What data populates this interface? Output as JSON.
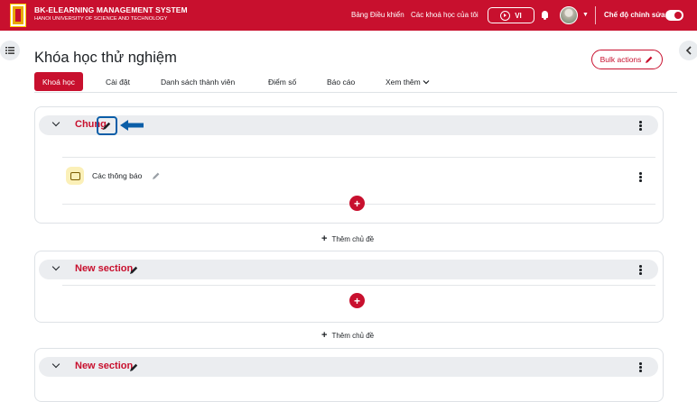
{
  "navbar": {
    "brand_title": "BK-ELEARNING MANAGEMENT SYSTEM",
    "brand_subtitle": "HANOI UNIVERSITY OF SCIENCE AND TECHNOLOGY",
    "dashboard_link": "Bảng Điều khiển",
    "my_courses_link": "Các khoá học của tôi",
    "language": "VI",
    "edit_mode_label": "Chế độ chỉnh sửa"
  },
  "header": {
    "title": "Khóa học thử nghiệm",
    "bulk_actions": "Bulk actions"
  },
  "tabs": [
    {
      "label": "Khoá học",
      "active": true
    },
    {
      "label": "Cài đặt"
    },
    {
      "label": "Danh sách thành viên"
    },
    {
      "label": "Điểm số"
    },
    {
      "label": "Báo cáo"
    },
    {
      "label": "Xem thêm"
    }
  ],
  "sections": [
    {
      "title": "Chung",
      "activity": "Các thông báo"
    },
    {
      "title": "New section"
    },
    {
      "title": "New section"
    }
  ],
  "add_topic_label": "Thêm chủ đề",
  "colors": {
    "brand": "#c8102e",
    "highlight": "#0b5ea8"
  }
}
